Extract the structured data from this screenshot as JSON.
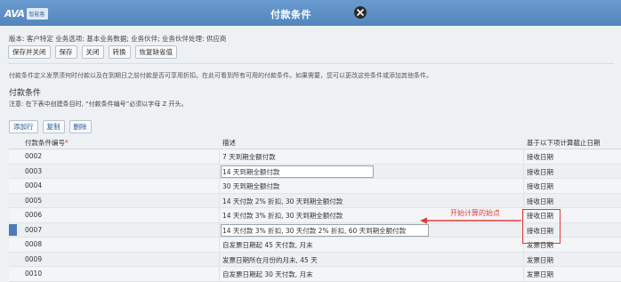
{
  "header": {
    "logo_text": "AVA",
    "logo_sub": "智能客",
    "title": "付款条件"
  },
  "info": {
    "text": "版本: 客户特定   业务选项: 基本业务数据; 业务伙伴; 业务伙伴处理: 供应商"
  },
  "toolbar": {
    "save_close": "保存并关闭",
    "save": "保存",
    "close": "关闭",
    "convert": "转换",
    "restore": "恢复缺省值"
  },
  "note": "付款条件定义发票须何时付款以及在到期日之前付款是否可享用折扣。在此可看到所有可用的付款条件。如果需要，您可以更改这些条件或添加其他条件。",
  "section": {
    "title": "付款条件",
    "note": "注意: 在下表中创建条目时, “付款条件编号”必须以字母 Z 开头。",
    "add_row": "添加行",
    "copy": "复制",
    "delete": "删除"
  },
  "table": {
    "col_id": "付款条件编号",
    "required_mark": "*",
    "col_desc": "描述",
    "col_base": "基于以下项计算截止日期",
    "rows": [
      {
        "id": "0002",
        "desc": "7 天到期全额付款",
        "base": "接收日期"
      },
      {
        "id": "0003",
        "desc": "14 天到期全额付款",
        "base": "接收日期"
      },
      {
        "id": "0004",
        "desc": "30 天到期全额付款",
        "base": "接收日期"
      },
      {
        "id": "0005",
        "desc": "14 天付款 2% 折扣, 30 天到期全额付款",
        "base": "接收日期"
      },
      {
        "id": "0006",
        "desc": "14 天付款 3% 折扣, 30 天到期全额付款",
        "base": "接收日期"
      },
      {
        "id": "0007",
        "desc": "14 天付款 3% 折扣, 30 天付款 2% 折扣, 60 天到期全额付款",
        "base": "接收日期"
      },
      {
        "id": "0008",
        "desc": "自发票日期起 45 天付款, 月末",
        "base": "发票日期"
      },
      {
        "id": "0009",
        "desc": "发票日期所在月份的月末, 45 天",
        "base": "发票日期"
      },
      {
        "id": "0010",
        "desc": "自发票日期起 30 天付款, 月末",
        "base": "发票日期"
      }
    ]
  },
  "annotation": "开始计算的始点",
  "colors": {
    "header": "#5c8fc6",
    "accent_red": "#e23a3a",
    "selection": "#4c7bb5"
  }
}
